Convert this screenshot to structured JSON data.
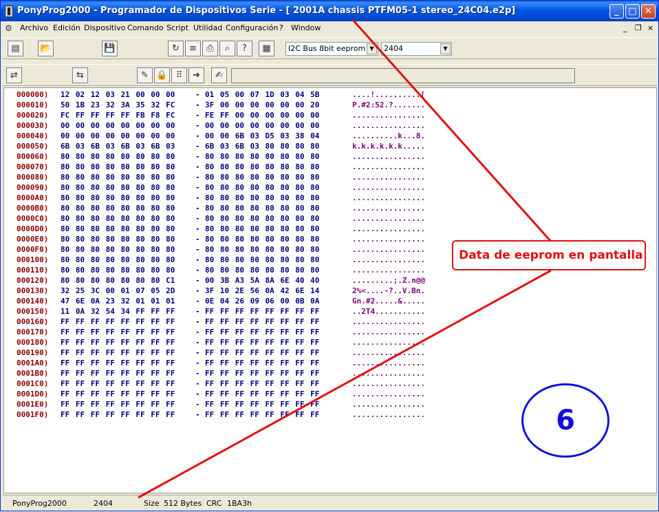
{
  "window": {
    "title": "PonyProg2000 - Programador de Dispositivos Serie - [ 2001A chassis  PTFM05-1 stereo_24C04.e2p]",
    "controls": {
      "minimize": "_",
      "maximize": "□",
      "close": "✕"
    }
  },
  "menu": {
    "items": [
      "Archivo",
      "Edición",
      "Dispositivo",
      "Comando",
      "Script",
      "Utilidad",
      "Configuración",
      "?",
      "Window"
    ],
    "mdi": {
      "minimize": "_",
      "restore": "❐",
      "close": "×"
    }
  },
  "toolbar": {
    "bus_select": "I2C Bus 8bit eeprom",
    "device_select": "2404"
  },
  "hex": {
    "rows": [
      {
        "addr": "000000)",
        "lo": "12 02 12 03 21 00 00 00",
        "hi": "01 05 00 07 1D 03 04 5B",
        "ascii": "....!..........["
      },
      {
        "addr": "000010)",
        "lo": "50 1B 23 32 3A 35 32 FC",
        "hi": "3F 00 00 00 00 00 00 20",
        "ascii": "P.#2:52.?......."
      },
      {
        "addr": "000020)",
        "lo": "FC FF FF FF FF FB F8 FC",
        "hi": "FE FF 00 00 00 00 00 00",
        "ascii": "................"
      },
      {
        "addr": "000030)",
        "lo": "00 00 00 00 00 00 00 00",
        "hi": "00 00 00 00 00 00 00 00",
        "ascii": "................"
      },
      {
        "addr": "000040)",
        "lo": "00 00 00 00 00 00 00 00",
        "hi": "00 00 6B 03 D5 03 38 04",
        "ascii": "..........k...8."
      },
      {
        "addr": "000050)",
        "lo": "6B 03 6B 03 6B 03 6B 03",
        "hi": "6B 03 6B 03 80 80 80 80",
        "ascii": "k.k.k.k.k.k....."
      },
      {
        "addr": "000060)",
        "lo": "80 80 80 80 80 80 80 80",
        "hi": "80 80 80 80 80 80 80 80",
        "ascii": "................"
      },
      {
        "addr": "000070)",
        "lo": "80 80 80 80 80 80 80 80",
        "hi": "80 80 80 80 80 80 80 80",
        "ascii": "................"
      },
      {
        "addr": "000080)",
        "lo": "80 80 80 80 80 80 80 80",
        "hi": "80 80 80 80 80 80 80 80",
        "ascii": "................"
      },
      {
        "addr": "000090)",
        "lo": "80 80 80 80 80 80 80 80",
        "hi": "80 80 80 80 80 80 80 80",
        "ascii": "................"
      },
      {
        "addr": "0000A0)",
        "lo": "80 80 80 80 80 80 80 80",
        "hi": "80 80 80 80 80 80 80 80",
        "ascii": "................"
      },
      {
        "addr": "0000B0)",
        "lo": "80 80 80 80 80 80 80 80",
        "hi": "80 80 80 80 80 80 80 80",
        "ascii": "................"
      },
      {
        "addr": "0000C0)",
        "lo": "80 80 80 80 80 80 80 80",
        "hi": "80 80 80 80 80 80 80 80",
        "ascii": "................"
      },
      {
        "addr": "0000D0)",
        "lo": "80 80 80 80 80 80 80 80",
        "hi": "80 80 80 80 80 80 80 80",
        "ascii": "................"
      },
      {
        "addr": "0000E0)",
        "lo": "80 80 80 80 80 80 80 80",
        "hi": "80 80 80 80 80 80 80 80",
        "ascii": "................"
      },
      {
        "addr": "0000F0)",
        "lo": "80 80 80 80 80 80 80 80",
        "hi": "80 80 80 80 80 80 80 80",
        "ascii": "................"
      },
      {
        "addr": "000100)",
        "lo": "80 80 80 80 80 80 80 80",
        "hi": "80 80 80 80 80 80 80 80",
        "ascii": "................"
      },
      {
        "addr": "000110)",
        "lo": "80 80 80 80 80 80 80 80",
        "hi": "80 80 80 80 80 80 80 80",
        "ascii": "................"
      },
      {
        "addr": "000120)",
        "lo": "80 80 80 80 80 80 80 C1",
        "hi": "00 3B A3 5A 8A 6E 40 40",
        "ascii": ".........;.Z.n@@"
      },
      {
        "addr": "000130)",
        "lo": "32 25 3C 00 01 07 05 2D",
        "hi": "3F 10 2E 56 0A 42 6E 14",
        "ascii": "2%<....-?..V.Bn."
      },
      {
        "addr": "000140)",
        "lo": "47 6E 0A 23 32 01 01 01",
        "hi": "0E 04 26 09 06 00 0B 0A",
        "ascii": "Gn.#2.....&....."
      },
      {
        "addr": "000150)",
        "lo": "11 0A 32 54 34 FF FF FF",
        "hi": "FF FF FF FF FF FF FF FF",
        "ascii": "..2T4..........."
      },
      {
        "addr": "000160)",
        "lo": "FF FF FF FF FF FF FF FF",
        "hi": "FF FF FF FF FF FF FF FF",
        "ascii": "................"
      },
      {
        "addr": "000170)",
        "lo": "FF FF FF FF FF FF FF FF",
        "hi": "FF FF FF FF FF FF FF FF",
        "ascii": "................"
      },
      {
        "addr": "000180)",
        "lo": "FF FF FF FF FF FF FF FF",
        "hi": "FF FF FF FF FF FF FF FF",
        "ascii": "................"
      },
      {
        "addr": "000190)",
        "lo": "FF FF FF FF FF FF FF FF",
        "hi": "FF FF FF FF FF FF FF FF",
        "ascii": "................"
      },
      {
        "addr": "0001A0)",
        "lo": "FF FF FF FF FF FF FF FF",
        "hi": "FF FF FF FF FF FF FF FF",
        "ascii": "................"
      },
      {
        "addr": "0001B0)",
        "lo": "FF FF FF FF FF FF FF FF",
        "hi": "FF FF FF FF FF FF FF FF",
        "ascii": "................"
      },
      {
        "addr": "0001C0)",
        "lo": "FF FF FF FF FF FF FF FF",
        "hi": "FF FF FF FF FF FF FF FF",
        "ascii": "................"
      },
      {
        "addr": "0001D0)",
        "lo": "FF FF FF FF FF FF FF FF",
        "hi": "FF FF FF FF FF FF FF FF",
        "ascii": "................"
      },
      {
        "addr": "0001E0)",
        "lo": "FF FF FF FF FF FF FF FF",
        "hi": "FF FF FF FF FF FF FF FF",
        "ascii": "................"
      },
      {
        "addr": "0001F0)",
        "lo": "FF FF FF FF FF FF FF FF",
        "hi": "FF FF FF FF FF FF FF FF",
        "ascii": "................"
      }
    ]
  },
  "annotations": {
    "callout": "Data de eeprom en pantalla",
    "step": "6",
    "line_color": "#e01010",
    "circle_color": "#1010e0"
  },
  "status": {
    "app": "PonyProg2000",
    "device": "2404",
    "size_label": "Size",
    "size_value": "512 Bytes",
    "crc_label": "CRC",
    "crc_value": "1BA3h"
  }
}
